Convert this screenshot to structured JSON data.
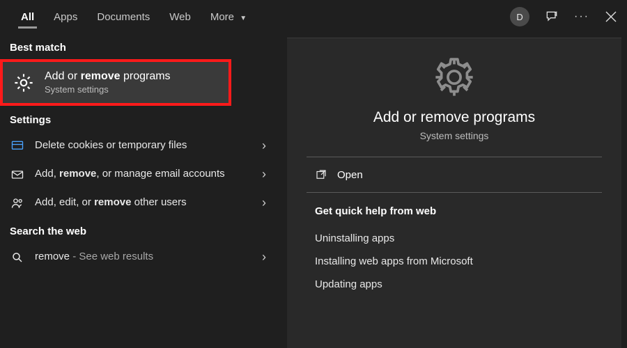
{
  "tabs": {
    "all": "All",
    "apps": "Apps",
    "documents": "Documents",
    "web": "Web",
    "more": "More"
  },
  "user": {
    "initial": "D"
  },
  "sections": {
    "best_match": "Best match",
    "settings": "Settings",
    "search_web": "Search the web"
  },
  "best_match": {
    "title_pre": "Add or ",
    "title_bold": "remove",
    "title_post": " programs",
    "subtitle": "System settings"
  },
  "settings_rows": [
    {
      "text": "Delete cookies or temporary files",
      "bold": ""
    },
    {
      "pre": "Add, ",
      "bold": "remove",
      "post": ", or manage email accounts"
    },
    {
      "pre": "Add, edit, or ",
      "bold": "remove",
      "post": " other users"
    }
  ],
  "web_row": {
    "term": "remove",
    "suffix": " - See web results"
  },
  "preview": {
    "title": "Add or remove programs",
    "subtitle": "System settings",
    "open": "Open"
  },
  "help": {
    "title": "Get quick help from web",
    "links": [
      "Uninstalling apps",
      "Installing web apps from Microsoft",
      "Updating apps"
    ]
  }
}
